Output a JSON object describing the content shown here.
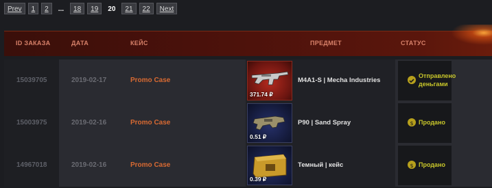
{
  "pagination": {
    "prev": "Prev",
    "pages": [
      "1",
      "2"
    ],
    "dots": "...",
    "pages2": [
      "18",
      "19"
    ],
    "current": "20",
    "pages3": [
      "21",
      "22"
    ],
    "next": "Next"
  },
  "table": {
    "headers": {
      "id": "ID ЗАКАЗА",
      "date": "ДАТА",
      "case": "КЕЙС",
      "item": "ПРЕДМЕТ",
      "status": "СТАТУС"
    },
    "rows": [
      {
        "id": "15039705",
        "date": "2019-02-17",
        "case": "Promo Case",
        "price": "371.74 ₽",
        "item": "M4A1-S | Mecha Industries",
        "status_line1": "Отправлено",
        "status_line2": "деньгами",
        "status_icon": "check-icon",
        "image": "red"
      },
      {
        "id": "15003975",
        "date": "2019-02-16",
        "case": "Promo Case",
        "price": "0.51 ₽",
        "item": "P90 | Sand Spray",
        "status_line1": "Продано",
        "status_line2": "",
        "status_icon": "coin-icon",
        "image": "blue"
      },
      {
        "id": "14967018",
        "date": "2019-02-16",
        "case": "Promo Case",
        "price": "0.39 ₽",
        "item": "Темный | кейс",
        "status_line1": "Продано",
        "status_line2": "",
        "status_icon": "coin-icon",
        "image": "blue"
      }
    ]
  },
  "colors": {
    "header_bg": "#4a110b",
    "case_link": "#d86a32",
    "status_text": "#c8c62a"
  }
}
